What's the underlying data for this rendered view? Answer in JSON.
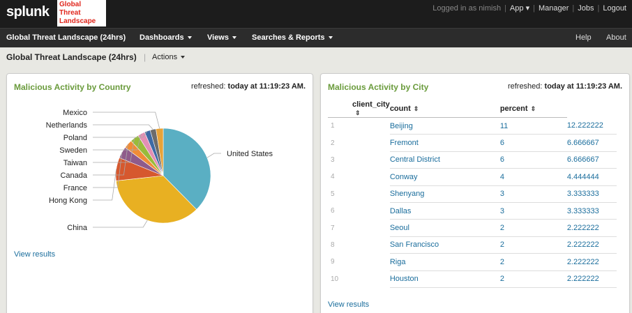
{
  "header": {
    "logo": "splunk",
    "app_logo_lines": [
      "Global",
      "Threat",
      "Landscape"
    ],
    "logged_in": "Logged in as nimish",
    "app_menu": "App",
    "manager": "Manager",
    "jobs": "Jobs",
    "logout": "Logout"
  },
  "nav": {
    "items": [
      "Global Threat Landscape (24hrs)",
      "Dashboards",
      "Views",
      "Searches & Reports"
    ],
    "help": "Help",
    "about": "About"
  },
  "titlebar": {
    "title": "Global Threat Landscape (24hrs)",
    "actions": "Actions"
  },
  "left_panel": {
    "title": "Malicious Activity by Country",
    "refreshed_label": "refreshed:",
    "refreshed_value": "today at 11:19:23 AM.",
    "view_results": "View results"
  },
  "right_panel": {
    "title": "Malicious Activity by City",
    "refreshed_label": "refreshed:",
    "refreshed_value": "today at 11:19:23 AM.",
    "view_results": "View results",
    "columns": [
      "client_city",
      "count",
      "percent"
    ],
    "rows": [
      {
        "n": "1",
        "city": "Beijing",
        "count": "11",
        "percent": "12.222222"
      },
      {
        "n": "2",
        "city": "Fremont",
        "count": "6",
        "percent": "6.666667"
      },
      {
        "n": "3",
        "city": "Central District",
        "count": "6",
        "percent": "6.666667"
      },
      {
        "n": "4",
        "city": "Conway",
        "count": "4",
        "percent": "4.444444"
      },
      {
        "n": "5",
        "city": "Shenyang",
        "count": "3",
        "percent": "3.333333"
      },
      {
        "n": "6",
        "city": "Dallas",
        "count": "3",
        "percent": "3.333333"
      },
      {
        "n": "7",
        "city": "Seoul",
        "count": "2",
        "percent": "2.222222"
      },
      {
        "n": "8",
        "city": "San Francisco",
        "count": "2",
        "percent": "2.222222"
      },
      {
        "n": "9",
        "city": "Riga",
        "count": "2",
        "percent": "2.222222"
      },
      {
        "n": "10",
        "city": "Houston",
        "count": "2",
        "percent": "2.222222"
      }
    ]
  },
  "chart_data": {
    "type": "pie",
    "categories": [
      "United States",
      "China",
      "Hong Kong",
      "France",
      "Canada",
      "Taiwan",
      "Sweden",
      "Poland",
      "Netherlands",
      "Mexico"
    ],
    "values": [
      38,
      36,
      8,
      4,
      3,
      3,
      2.5,
      2,
      2,
      2.5
    ],
    "colors": [
      "#5aafc3",
      "#e8b022",
      "#d6582e",
      "#8f5b8b",
      "#f08c36",
      "#98bb3a",
      "#e38fb4",
      "#3d6aa5",
      "#6c6c6c",
      "#e7a339"
    ]
  }
}
